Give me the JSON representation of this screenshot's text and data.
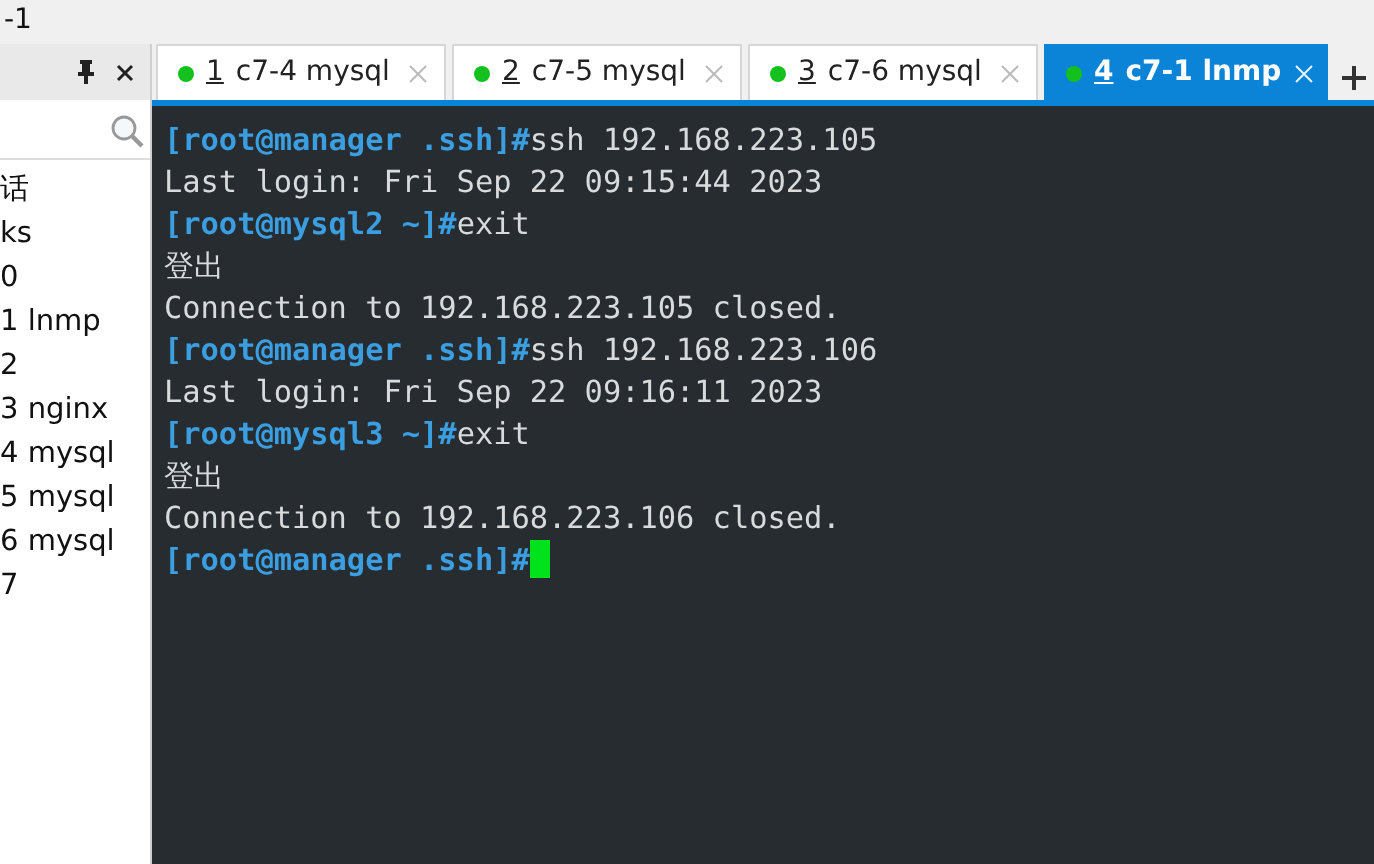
{
  "window": {
    "title": "-1"
  },
  "sidebar": {
    "items": [
      {
        "label": "话"
      },
      {
        "label": "ks"
      },
      {
        "label": "0"
      },
      {
        "label": "1 lnmp"
      },
      {
        "label": "2"
      },
      {
        "label": "3 nginx"
      },
      {
        "label": "4 mysql"
      },
      {
        "label": "5 mysql"
      },
      {
        "label": "6 mysql"
      },
      {
        "label": "7"
      }
    ]
  },
  "tabs": [
    {
      "number": "1",
      "label": "c7-4 mysql",
      "selected": false,
      "connected": true
    },
    {
      "number": "2",
      "label": "c7-5 mysql",
      "selected": false,
      "connected": true
    },
    {
      "number": "3",
      "label": "c7-6 mysql",
      "selected": false,
      "connected": true
    },
    {
      "number": "4",
      "label": "c7-1 lnmp",
      "selected": true,
      "connected": true
    }
  ],
  "terminal": {
    "lines": [
      {
        "prompt": "[root@manager .ssh]#",
        "text": "ssh 192.168.223.105"
      },
      {
        "text": "Last login: Fri Sep 22 09:15:44 2023"
      },
      {
        "prompt": "[root@mysql2 ~]#",
        "text": "exit"
      },
      {
        "text": "登出"
      },
      {
        "text": "Connection to 192.168.223.105 closed."
      },
      {
        "prompt": "[root@manager .ssh]#",
        "text": "ssh 192.168.223.106"
      },
      {
        "text": "Last login: Fri Sep 22 09:16:11 2023"
      },
      {
        "prompt": "[root@mysql3 ~]#",
        "text": "exit"
      },
      {
        "text": "登出"
      },
      {
        "text": "Connection to 192.168.223.106 closed."
      },
      {
        "prompt": "[root@manager .ssh]#",
        "cursor": true
      }
    ]
  }
}
